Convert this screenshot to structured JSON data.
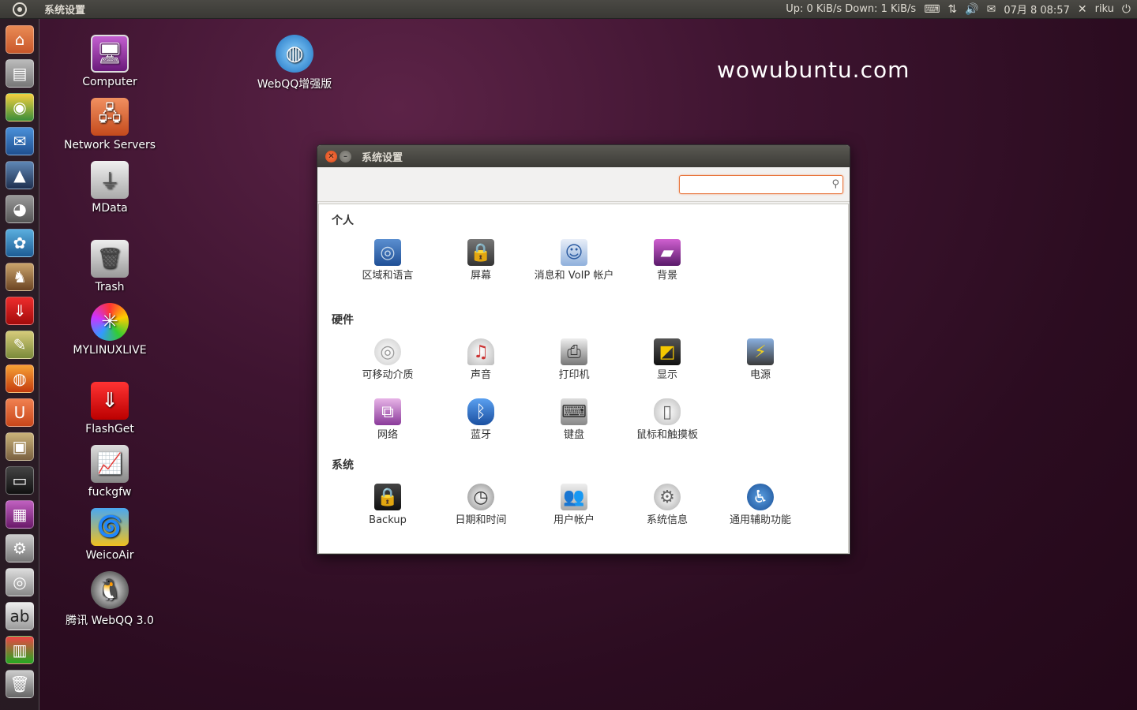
{
  "top_panel": {
    "app_title": "系统设置",
    "network_speed": "Up: 0 KiB/s Down: 1 KiB/s",
    "clock": "07月 8 08:57",
    "user": "riku"
  },
  "watermark": "wowubuntu.com",
  "desktop_icons": [
    {
      "label": "Computer"
    },
    {
      "label": "Network Servers"
    },
    {
      "label": "MData"
    },
    {
      "label": "Trash"
    },
    {
      "label": "MYLINUXLIVE"
    },
    {
      "label": "FlashGet"
    },
    {
      "label": "fuckgfw"
    },
    {
      "label": "WeicoAir"
    },
    {
      "label": "腾讯 WebQQ 3.0"
    },
    {
      "label": "WebQQ增强版"
    }
  ],
  "window": {
    "title": "系统设置",
    "search": {
      "value": "",
      "placeholder": ""
    },
    "sections": [
      {
        "title": "个人",
        "items": [
          {
            "label": "区域和语言"
          },
          {
            "label": "屏幕"
          },
          {
            "label": "消息和 VoIP 帐户"
          },
          {
            "label": "背景"
          }
        ]
      },
      {
        "title": "硬件",
        "items": [
          {
            "label": "可移动介质"
          },
          {
            "label": "声音"
          },
          {
            "label": "打印机"
          },
          {
            "label": "显示"
          },
          {
            "label": "电源"
          },
          {
            "label": "网络"
          },
          {
            "label": "蓝牙"
          },
          {
            "label": "键盘"
          },
          {
            "label": "鼠标和触摸板"
          }
        ]
      },
      {
        "title": "系统",
        "items": [
          {
            "label": "Backup"
          },
          {
            "label": "日期和时间"
          },
          {
            "label": "用户帐户"
          },
          {
            "label": "系统信息"
          },
          {
            "label": "通用辅助功能"
          }
        ]
      }
    ]
  },
  "colors": {
    "accent": "#dd4814",
    "panel": "#3c3b37",
    "desktop": "#3e1430"
  }
}
